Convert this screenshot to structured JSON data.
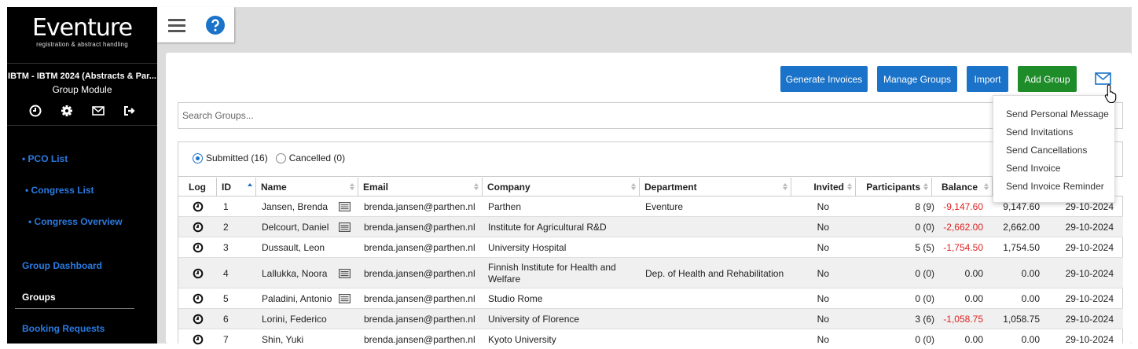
{
  "brand": {
    "name": "Eventure",
    "tagline": "registration & abstract handling"
  },
  "event": {
    "title": "IBTM - IBTM 2024 (Abstracts & Par...",
    "module": "Group Module"
  },
  "sidebar": {
    "icons": [
      "clock-icon",
      "gear-icon",
      "mail-icon",
      "sign-out-icon"
    ],
    "links": [
      {
        "label": "• PCO List"
      },
      {
        "label": "• Congress List"
      },
      {
        "label": "• Congress Overview"
      },
      {
        "label": "Group Dashboard"
      },
      {
        "label": "Groups"
      },
      {
        "label": "Booking Requests"
      }
    ]
  },
  "toolbar": {
    "generate_invoices": "Generate Invoices",
    "manage_groups": "Manage Groups",
    "import": "Import",
    "add_group": "Add Group"
  },
  "search": {
    "placeholder": "Search Groups..."
  },
  "filters": {
    "submitted": "Submitted (16)",
    "cancelled": "Cancelled (0)"
  },
  "table": {
    "headers": [
      "Log",
      "ID",
      "Name",
      "Email",
      "Company",
      "Department",
      "Invited",
      "Participants",
      "Balance"
    ],
    "rows": [
      {
        "id": "1",
        "name": "Jansen, Brenda",
        "has_card": true,
        "email": "brenda.jansen@parthen.nl",
        "company": "Parthen",
        "department": "Eventure",
        "invited": "No",
        "participants": "8 (9)",
        "balance": "-9,147.60",
        "paid": "9,147.60",
        "date": "29-10-2024"
      },
      {
        "id": "2",
        "name": "Delcourt, Daniel",
        "has_card": true,
        "email": "brenda.jansen@parthen.nl",
        "company": "Institute for Agricultural R&D",
        "department": "",
        "invited": "No",
        "participants": "0 (0)",
        "balance": "-2,662.00",
        "paid": "2,662.00",
        "date": "29-10-2024"
      },
      {
        "id": "3",
        "name": "Dussault, Leon",
        "has_card": false,
        "email": "brenda.jansen@parthen.nl",
        "company": "University Hospital",
        "department": "",
        "invited": "No",
        "participants": "5 (5)",
        "balance": "-1,754.50",
        "paid": "1,754.50",
        "date": "29-10-2024"
      },
      {
        "id": "4",
        "name": "Lallukka, Noora",
        "has_card": true,
        "email": "brenda.jansen@parthen.nl",
        "company": "Finnish Institute for Health and Welfare",
        "department": "Dep. of Health and Rehabilitation",
        "invited": "No",
        "participants": "0 (0)",
        "balance": "0.00",
        "paid": "0.00",
        "date": "29-10-2024"
      },
      {
        "id": "5",
        "name": "Paladini, Antonio",
        "has_card": true,
        "email": "brenda.jansen@parthen.nl",
        "company": "Studio Rome",
        "department": "",
        "invited": "No",
        "participants": "0 (0)",
        "balance": "0.00",
        "paid": "0.00",
        "date": "29-10-2024"
      },
      {
        "id": "6",
        "name": "Lorini, Federico",
        "has_card": false,
        "email": "brenda.jansen@parthen.nl",
        "company": "University of Florence",
        "department": "",
        "invited": "No",
        "participants": "3 (6)",
        "balance": "-1,058.75",
        "paid": "1,058.75",
        "date": "29-10-2024"
      },
      {
        "id": "7",
        "name": "Shin, Yuki",
        "has_card": false,
        "email": "brenda.jansen@parthen.nl",
        "company": "Kyoto University",
        "department": "",
        "invited": "No",
        "participants": "0 (0)",
        "balance": "0.00",
        "paid": "0.00",
        "date": "29-10-2024"
      }
    ]
  },
  "mail_menu": {
    "items": [
      "Send Personal Message",
      "Send Invitations",
      "Send Cancellations",
      "Send Invoice",
      "Send Invoice Reminder"
    ]
  },
  "colors": {
    "primary": "#1a73c8",
    "success": "#1f8c2a",
    "negative": "#d22222",
    "link": "#2a7ae2"
  }
}
